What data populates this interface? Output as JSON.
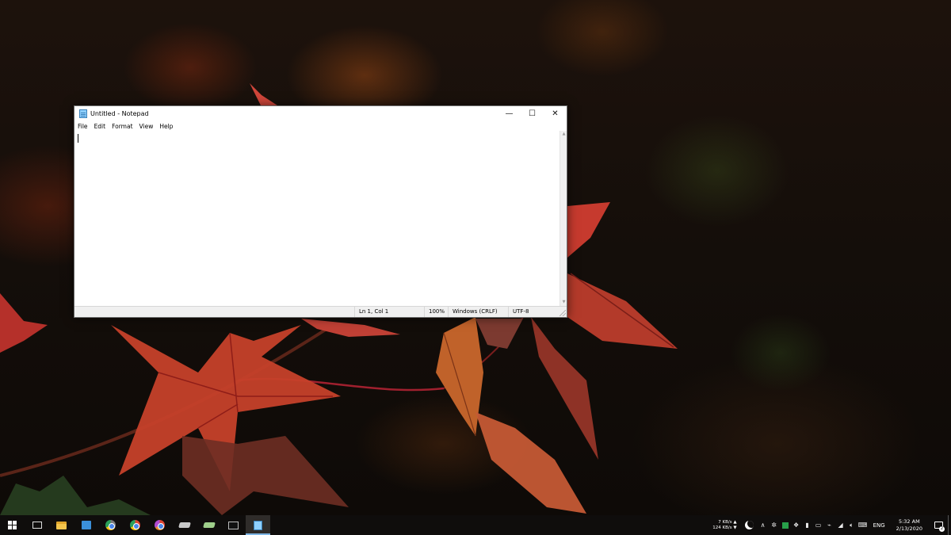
{
  "window": {
    "title": "Untitled - Notepad",
    "controls": {
      "minimize": "—",
      "maximize": "☐",
      "close": "✕"
    }
  },
  "menu": [
    "File",
    "Edit",
    "Format",
    "View",
    "Help"
  ],
  "editor": {
    "content": ""
  },
  "status": {
    "position": "Ln 1, Col 1",
    "zoom": "100%",
    "line_endings": "Windows (CRLF)",
    "encoding": "UTF-8"
  },
  "taskbar": {
    "apps": [
      {
        "icon": "windows-start-icon"
      },
      {
        "icon": "task-view-icon"
      },
      {
        "icon": "file-explorer-icon"
      },
      {
        "icon": "microsoft-store-icon"
      },
      {
        "icon": "chrome-icon"
      },
      {
        "icon": "chrome-icon"
      },
      {
        "icon": "chrome-icon"
      },
      {
        "icon": "drive-icon"
      },
      {
        "icon": "drive-icon"
      },
      {
        "icon": "terminal-icon"
      },
      {
        "icon": "notepad-icon",
        "active": true
      }
    ],
    "tray": {
      "upload_speed": "7 KB/s",
      "download_speed": "124 KB/s",
      "up_arrow": "▲",
      "down_arrow": "▼",
      "chevron": "∧",
      "language": "ENG",
      "time": "5:32 AM",
      "date": "2/13/2020",
      "notification_count": "2"
    }
  },
  "colors": {
    "notepad_active_indicator": "#7fb7e6",
    "taskbar_bg": "#0f0d0c"
  }
}
